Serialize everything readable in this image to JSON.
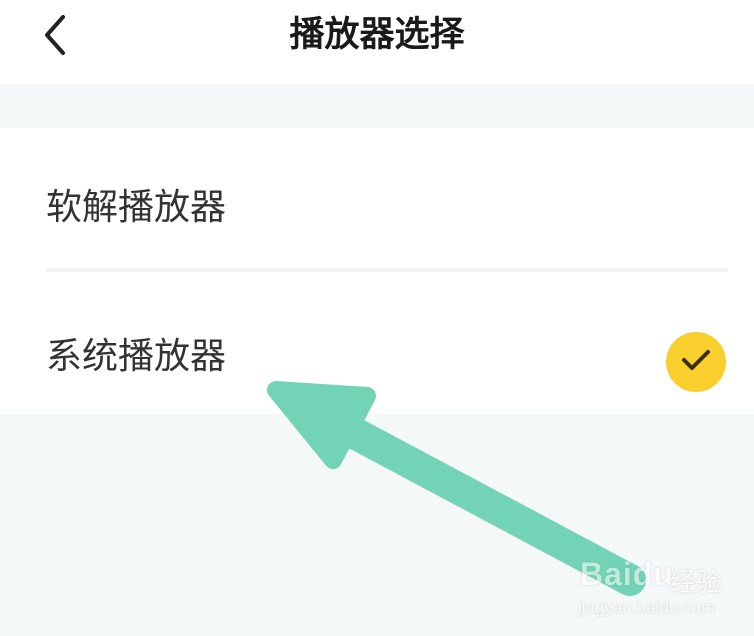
{
  "header": {
    "title": "播放器选择",
    "back_icon": "chevron-left-icon"
  },
  "list": {
    "items": [
      {
        "label": "软解播放器",
        "selected": false
      },
      {
        "label": "系统播放器",
        "selected": true,
        "check_icon": "check-icon"
      }
    ]
  },
  "watermark": {
    "brand": "Baidu",
    "sub": "经验",
    "url": "jingyan.baidu.com"
  },
  "colors": {
    "accent_check": "#f8cf2d",
    "arrow": "#72d3b7",
    "background": "#f4f8f8"
  }
}
